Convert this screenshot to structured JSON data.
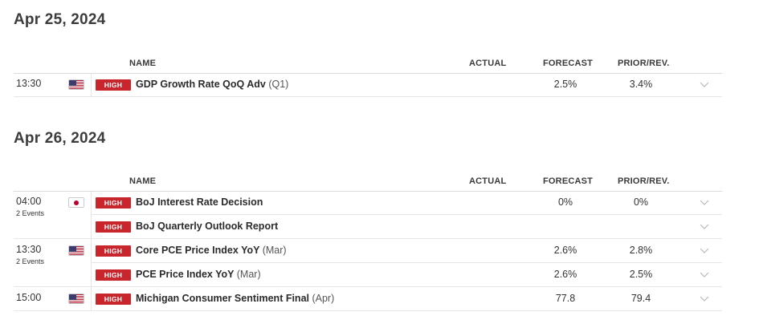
{
  "columns": {
    "name": "NAME",
    "actual": "ACTUAL",
    "forecast": "FORECAST",
    "prior": "PRIOR/REV."
  },
  "importance_label": "HIGH",
  "colors": {
    "importance_high": "#c9252c"
  },
  "days": [
    {
      "date": "Apr 25, 2024",
      "events": [
        {
          "time": "13:30",
          "events_count": "",
          "flag_icon": "us-flag-icon",
          "name": "GDP Growth Rate QoQ Adv",
          "period": "(Q1)",
          "actual": "",
          "forecast": "2.5%",
          "prior": "3.4%"
        }
      ]
    },
    {
      "date": "Apr 26, 2024",
      "events": [
        {
          "time": "04:00",
          "events_count": "2 Events",
          "flag_icon": "japan-flag-icon",
          "name": "BoJ Interest Rate Decision",
          "period": "",
          "actual": "",
          "forecast": "0%",
          "prior": "0%"
        },
        {
          "time": "",
          "events_count": "",
          "flag_icon": "",
          "name": "BoJ Quarterly Outlook Report",
          "period": "",
          "actual": "",
          "forecast": "",
          "prior": ""
        },
        {
          "time": "13:30",
          "events_count": "2 Events",
          "flag_icon": "us-flag-icon",
          "name": "Core PCE Price Index YoY",
          "period": "(Mar)",
          "actual": "",
          "forecast": "2.6%",
          "prior": "2.8%"
        },
        {
          "time": "",
          "events_count": "",
          "flag_icon": "",
          "name": "PCE Price Index YoY",
          "period": "(Mar)",
          "actual": "",
          "forecast": "2.6%",
          "prior": "2.5%"
        },
        {
          "time": "15:00",
          "events_count": "",
          "flag_icon": "us-flag-icon",
          "name": "Michigan Consumer Sentiment Final",
          "period": "(Apr)",
          "actual": "",
          "forecast": "77.8",
          "prior": "79.4"
        }
      ]
    }
  ]
}
